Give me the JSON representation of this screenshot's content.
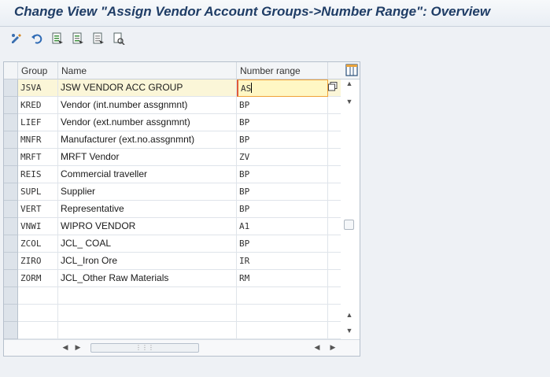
{
  "window": {
    "title": "Change View \"Assign Vendor Account Groups->Number Range\": Overview"
  },
  "toolbar": {
    "buttons": [
      {
        "name": "display-change-icon"
      },
      {
        "name": "undo-icon"
      },
      {
        "name": "select-all-icon"
      },
      {
        "name": "select-block-icon"
      },
      {
        "name": "deselect-all-icon"
      },
      {
        "name": "print-icon"
      }
    ]
  },
  "table": {
    "headers": {
      "group": "Group",
      "name": "Name",
      "number_range": "Number range"
    },
    "rows": [
      {
        "group": "JSVA",
        "name": "JSW VENDOR ACC GROUP",
        "number_range": "AS"
      },
      {
        "group": "KRED",
        "name": "Vendor (int.number assgnmnt)",
        "number_range": "BP"
      },
      {
        "group": "LIEF",
        "name": "Vendor (ext.number assgnmnt)",
        "number_range": "BP"
      },
      {
        "group": "MNFR",
        "name": "Manufacturer (ext.no.assgnmnt)",
        "number_range": "BP"
      },
      {
        "group": "MRFT",
        "name": "MRFT Vendor",
        "number_range": "ZV"
      },
      {
        "group": "REIS",
        "name": "Commercial traveller",
        "number_range": "BP"
      },
      {
        "group": "SUPL",
        "name": "Supplier",
        "number_range": "BP"
      },
      {
        "group": "VERT",
        "name": "Representative",
        "number_range": "BP"
      },
      {
        "group": "VNWI",
        "name": "WIPRO VENDOR",
        "number_range": "A1"
      },
      {
        "group": "ZCOL",
        "name": "JCL_ COAL",
        "number_range": "BP"
      },
      {
        "group": "ZIRO",
        "name": "JCL_Iron Ore",
        "number_range": "IR"
      },
      {
        "group": "ZORM",
        "name": "JCL_Other Raw Materials",
        "number_range": "RM"
      }
    ],
    "empty_rows": 3
  },
  "colors": {
    "title": "#1f3d66",
    "active_row": "#fbf6d8",
    "active_cell_border": "#f0a238"
  }
}
